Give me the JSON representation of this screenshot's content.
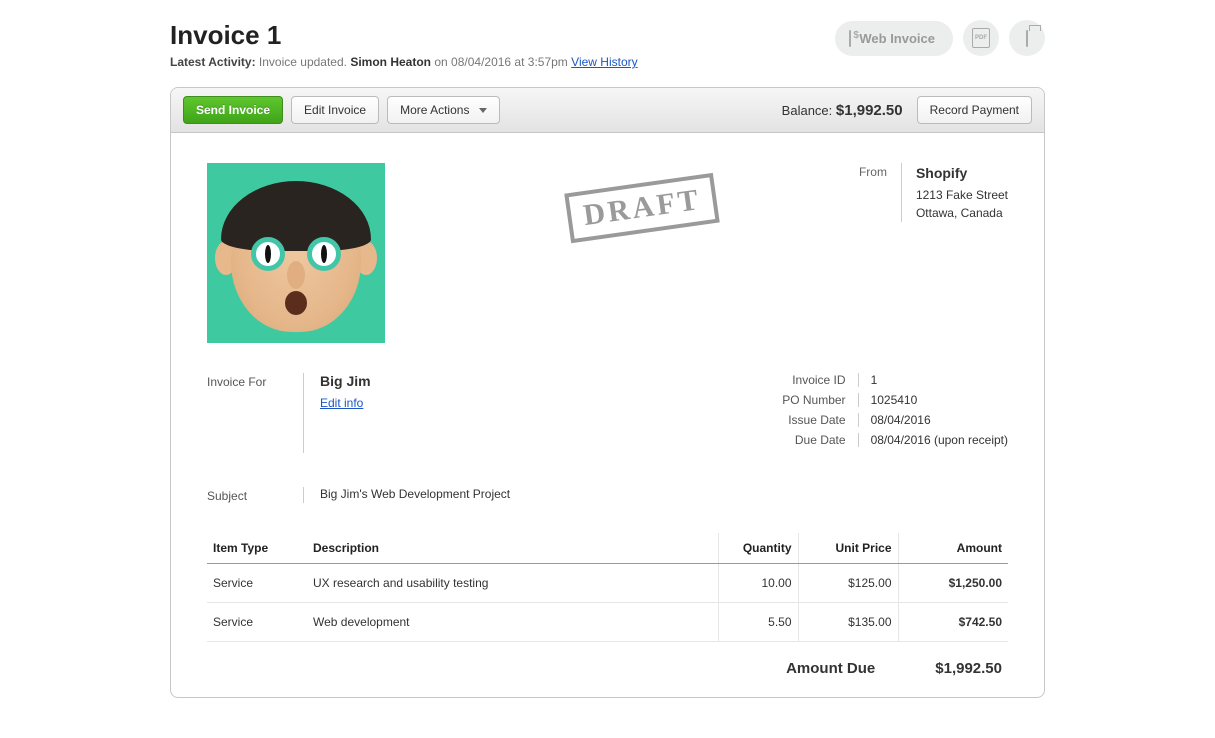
{
  "header": {
    "title": "Invoice 1",
    "activity_label": "Latest Activity:",
    "activity_text": "Invoice updated.",
    "author": "Simon Heaton",
    "on_text": "on 08/04/2016 at 3:57pm",
    "view_history": "View History",
    "web_invoice_label": "Web Invoice"
  },
  "toolbar": {
    "send_label": "Send Invoice",
    "edit_label": "Edit Invoice",
    "more_label": "More Actions",
    "balance_label": "Balance:",
    "balance_value": "$1,992.50",
    "record_payment_label": "Record Payment"
  },
  "stamp": "DRAFT",
  "from": {
    "label": "From",
    "company": "Shopify",
    "street": "1213 Fake Street",
    "city": "Ottawa, Canada"
  },
  "invoice_for": {
    "label": "Invoice For",
    "client": "Big Jim",
    "edit_link": "Edit info"
  },
  "meta": {
    "invoice_id_label": "Invoice ID",
    "invoice_id": "1",
    "po_label": "PO Number",
    "po": "1025410",
    "issue_label": "Issue Date",
    "issue": "08/04/2016",
    "due_label": "Due Date",
    "due": "08/04/2016 (upon receipt)"
  },
  "subject": {
    "label": "Subject",
    "value": "Big Jim's Web Development Project"
  },
  "columns": {
    "type": "Item Type",
    "desc": "Description",
    "qty": "Quantity",
    "price": "Unit Price",
    "amount": "Amount"
  },
  "items": [
    {
      "type": "Service",
      "desc": "UX research and usability testing",
      "qty": "10.00",
      "price": "$125.00",
      "amount": "$1,250.00"
    },
    {
      "type": "Service",
      "desc": "Web development",
      "qty": "5.50",
      "price": "$135.00",
      "amount": "$742.50"
    }
  ],
  "totals": {
    "label": "Amount Due",
    "value": "$1,992.50"
  }
}
